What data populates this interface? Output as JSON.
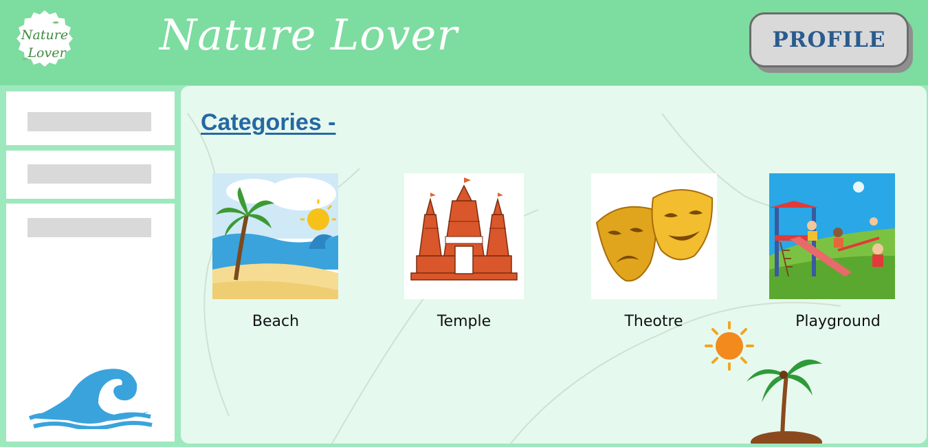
{
  "header": {
    "logo_line1": "Nature",
    "logo_line2": "Lover",
    "title": "Nature Lover",
    "profile_label": "PROFILE"
  },
  "sidebar": {
    "icon": "wave-icon"
  },
  "main": {
    "heading": "Categories -",
    "categories": [
      {
        "label": "Beach",
        "icon": "beach-image"
      },
      {
        "label": "Temple",
        "icon": "temple-image"
      },
      {
        "label": "Theotre",
        "icon": "theatre-masks-image"
      },
      {
        "label": "Playground",
        "icon": "playground-image"
      }
    ]
  },
  "colors": {
    "header_bg": "#7ddc9f",
    "page_bg": "#9ee8be",
    "panel_bg": "#e6f9ee",
    "heading": "#2568a3",
    "profile_text": "#2a5b8e"
  }
}
